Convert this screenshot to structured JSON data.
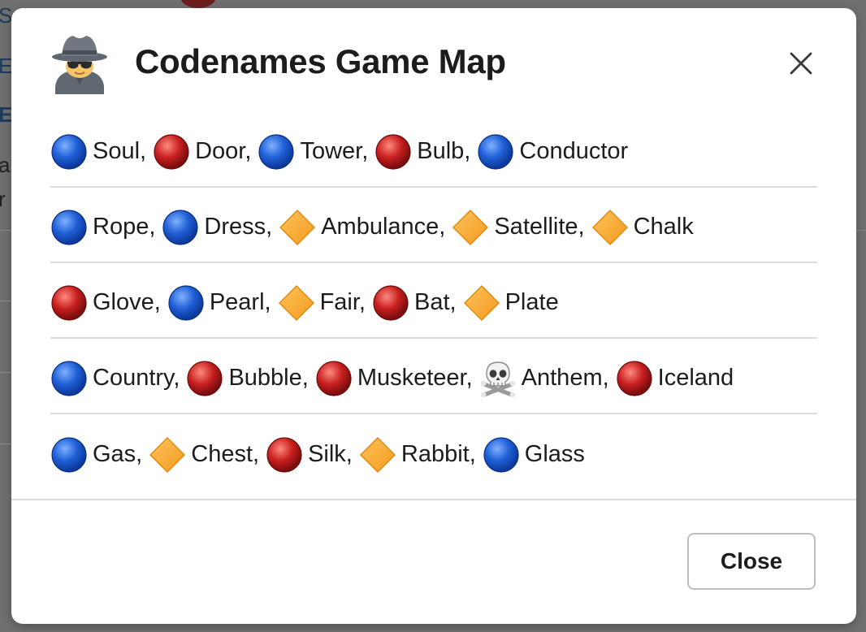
{
  "background": {
    "fragments": [
      "S",
      "E",
      "E",
      "a",
      "r"
    ]
  },
  "modal": {
    "title": "Codenames Game Map",
    "header_icon": "spy-icon",
    "close_icon": "close-icon",
    "close_button_label": "Close"
  },
  "legend_icons": {
    "blue": "blue-circle-icon",
    "red": "red-circle-icon",
    "neutral": "orange-diamond-icon",
    "assassin": "skull-crossbones-icon"
  },
  "colors": {
    "blue": "#1f5fd6",
    "red": "#c8201f",
    "neutral": "#f29a1f",
    "title": "#1d1c1d",
    "divider": "#dddddd"
  },
  "rows": [
    [
      {
        "type": "blue",
        "word": "Soul,"
      },
      {
        "type": "red",
        "word": "Door,"
      },
      {
        "type": "blue",
        "word": "Tower,"
      },
      {
        "type": "red",
        "word": "Bulb,"
      },
      {
        "type": "blue",
        "word": "Conductor"
      }
    ],
    [
      {
        "type": "blue",
        "word": "Rope,"
      },
      {
        "type": "blue",
        "word": "Dress,"
      },
      {
        "type": "neutral",
        "word": "Ambulance,"
      },
      {
        "type": "neutral",
        "word": "Satellite,"
      },
      {
        "type": "neutral",
        "word": "Chalk"
      }
    ],
    [
      {
        "type": "red",
        "word": "Glove,"
      },
      {
        "type": "blue",
        "word": "Pearl,"
      },
      {
        "type": "neutral",
        "word": "Fair,"
      },
      {
        "type": "red",
        "word": "Bat,"
      },
      {
        "type": "neutral",
        "word": "Plate"
      }
    ],
    [
      {
        "type": "blue",
        "word": "Country,"
      },
      {
        "type": "red",
        "word": "Bubble,"
      },
      {
        "type": "red",
        "word": "Musketeer,"
      },
      {
        "type": "assassin",
        "word": "Anthem,"
      },
      {
        "type": "red",
        "word": "Iceland"
      }
    ],
    [
      {
        "type": "blue",
        "word": "Gas,"
      },
      {
        "type": "neutral",
        "word": "Chest,"
      },
      {
        "type": "red",
        "word": "Silk,"
      },
      {
        "type": "neutral",
        "word": "Rabbit,"
      },
      {
        "type": "blue",
        "word": "Glass"
      }
    ]
  ]
}
